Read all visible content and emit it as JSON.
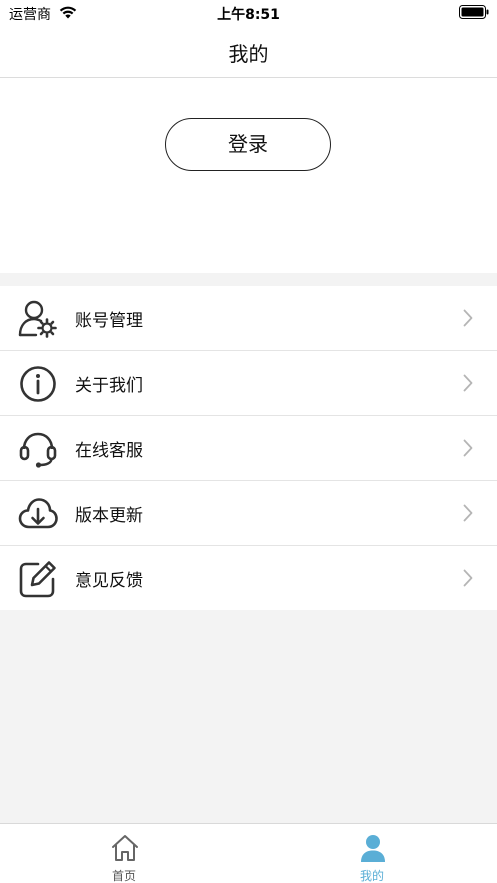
{
  "status_bar": {
    "carrier": "运营商",
    "time": "上午8:51",
    "wifi_icon": "wifi-icon",
    "battery_icon": "battery-icon"
  },
  "header": {
    "title": "我的"
  },
  "login": {
    "button_label": "登录"
  },
  "menu": {
    "items": [
      {
        "label": "账号管理",
        "icon": "account-settings-icon"
      },
      {
        "label": "关于我们",
        "icon": "info-icon"
      },
      {
        "label": "在线客服",
        "icon": "headset-icon"
      },
      {
        "label": "版本更新",
        "icon": "cloud-download-icon"
      },
      {
        "label": "意见反馈",
        "icon": "edit-icon"
      }
    ]
  },
  "tab_bar": {
    "tabs": [
      {
        "label": "首页",
        "icon": "home-icon",
        "active": false
      },
      {
        "label": "我的",
        "icon": "user-icon",
        "active": true
      }
    ]
  },
  "colors": {
    "accent": "#5aaed6",
    "background": "#f3f3f3",
    "divider": "#e4e4e4"
  }
}
